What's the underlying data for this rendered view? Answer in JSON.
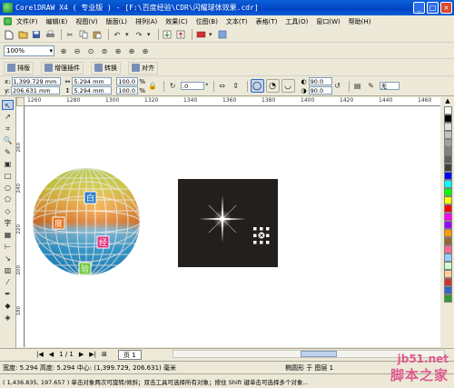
{
  "window": {
    "title": "CorelDRAW X4 ( 专业版 ) - [F:\\百度经验\\CDR\\闪耀球体效果.cdr]",
    "controls": [
      "_",
      "□",
      "×"
    ]
  },
  "menubar": {
    "items": [
      "文件(F)",
      "编辑(E)",
      "视图(V)",
      "版面(L)",
      "排列(A)",
      "效果(C)",
      "位图(B)",
      "文本(T)",
      "表格(T)",
      "工具(O)",
      "窗口(W)",
      "帮助(H)"
    ]
  },
  "standard_toolbar": {
    "icons": [
      "new-icon",
      "open-icon",
      "save-icon",
      "print-icon",
      "cut-icon",
      "copy-icon",
      "paste-icon",
      "undo-icon",
      "redo-icon",
      "import-icon",
      "export-icon",
      "app-launcher-icon"
    ]
  },
  "zoom_toolbar": {
    "zoom_value": "100%"
  },
  "plugin_toolbar": {
    "buttons": [
      "排版",
      "增强插件",
      "转换",
      "对齐"
    ]
  },
  "property_bar": {
    "x": "1,399.729 mm",
    "y": "206.631 mm",
    "width": "5.294 mm",
    "height": "5.294 mm",
    "scale_x": "100.0",
    "scale_y": "100.0",
    "percent_symbol": "%",
    "rotation": ".0",
    "corner1": "90.0",
    "corner2": "90.0",
    "outline": "无",
    "labels": {
      "x": "x:",
      "y": "y:",
      "degree": "°"
    }
  },
  "rulers": {
    "horizontal_ticks": [
      "1260",
      "1280",
      "1300",
      "1320",
      "1340",
      "1360",
      "1380",
      "1400",
      "1420",
      "1440",
      "1460"
    ],
    "vertical_ticks": [
      "260",
      "240",
      "220",
      "200",
      "180"
    ]
  },
  "canvas": {
    "sphere_labels": [
      "白",
      "度",
      "经",
      "验"
    ],
    "dark_panel_color": "#231f1c"
  },
  "palette_colors": [
    "#ffffff",
    "#000000",
    "#e0e0e0",
    "#c0c0c0",
    "#a0a0a0",
    "#808080",
    "#606060",
    "#404040",
    "#0000ff",
    "#00ffff",
    "#00ff00",
    "#ffff00",
    "#ff0000",
    "#ff00ff",
    "#9900ff",
    "#ff9900",
    "#996633",
    "#ff6699",
    "#99ccff",
    "#ccffcc",
    "#ffcc99",
    "#cc3333",
    "#3366cc",
    "#339933"
  ],
  "pagebar": {
    "page_count": "1 / 1",
    "page_tab": "页 1"
  },
  "status": {
    "line1_size": "宽度: 5.294  高度: 5.294  中心: (1,399.729, 206.631)  毫米",
    "line1_object": "椭圆形 于 图层 1",
    "line2": "( 1,436.835, 197.657 ) 单击对象两次可旋转/倾斜；双击工具可选择所有对象；按住 Shift 键单击可选择多个对象..."
  },
  "watermark": {
    "url": "jb51.net",
    "text": "脚本之家"
  }
}
